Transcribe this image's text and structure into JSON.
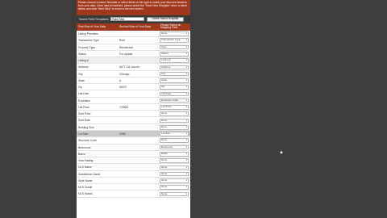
{
  "instructions": "Please choose a saved Template or select fields on the right to match your files and headers from your data. Once data is matched, please select the \"Save New Template\" when a name below, and click \"Next Step\" to move to the next screen.",
  "controls": {
    "template_label": "Saved Field Templates:",
    "template_value": "Paint Field",
    "delete_button": "Delete Saved Template"
  },
  "header": {
    "col1": "First Row of Your Data",
    "col2": "Second Row of Your Data",
    "col3_line1": "Please Select an",
    "col3_line2": "Mapping Field"
  },
  "rows": [
    {
      "c1": "Listing Premises",
      "c2": "",
      "dd": "None"
    },
    {
      "c1": "Transaction Type",
      "c2": "Rent",
      "dd": "Transaction Type"
    },
    {
      "c1": "Property Type",
      "c2": "Residential",
      "dd": "Type"
    },
    {
      "c1": "Status",
      "c2": "For update",
      "dd": "Status"
    },
    {
      "c1": "Listing #",
      "c2": "",
      "dd": "Listing #"
    },
    {
      "c1": "Address",
      "c2": "5677 111 Lincoln",
      "dd": "Address"
    },
    {
      "c1": "City",
      "c2": "Chicago",
      "dd": "City"
    },
    {
      "c1": "State",
      "c2": "IL",
      "dd": "State"
    },
    {
      "c1": "Zip",
      "c2": "60007",
      "dd": "Zip"
    },
    {
      "c1": "List Date",
      "c2": "",
      "dd": "List Date"
    },
    {
      "c1": "Expiration",
      "c2": "",
      "dd": "Expiration Date"
    },
    {
      "c1": "List Price",
      "c2": "729900",
      "dd": "List Price"
    },
    {
      "c1": "Sold Price",
      "c2": "",
      "dd": "None"
    },
    {
      "c1": "Sold Date",
      "c2": "",
      "dd": "None"
    },
    {
      "c1": "Building Size",
      "c2": "",
      "dd": "None"
    },
    {
      "c1": "Lot Size",
      "c2": "1285",
      "dd": "Lot Size"
    },
    {
      "c1": "Structure Code",
      "c2": "",
      "dd": "None"
    },
    {
      "c1": "Bedrooms",
      "c2": "",
      "dd": "Bedrooms"
    },
    {
      "c1": "Baths",
      "c2": "",
      "dd": "Baths"
    },
    {
      "c1": "Year Facility",
      "c2": "",
      "dd": "None"
    },
    {
      "c1": "MLS Name",
      "c2": "",
      "dd": "None"
    },
    {
      "c1": "Subdivision Name",
      "c2": "",
      "dd": "None"
    },
    {
      "c1": "Style Name",
      "c2": "",
      "dd": "None"
    },
    {
      "c1": "MLS Grade",
      "c2": "",
      "dd": "None"
    },
    {
      "c1": "MLS Status",
      "c2": "",
      "dd": "None"
    }
  ],
  "colors": {
    "accent": "#a0381d",
    "background": "#3d3d3d"
  }
}
